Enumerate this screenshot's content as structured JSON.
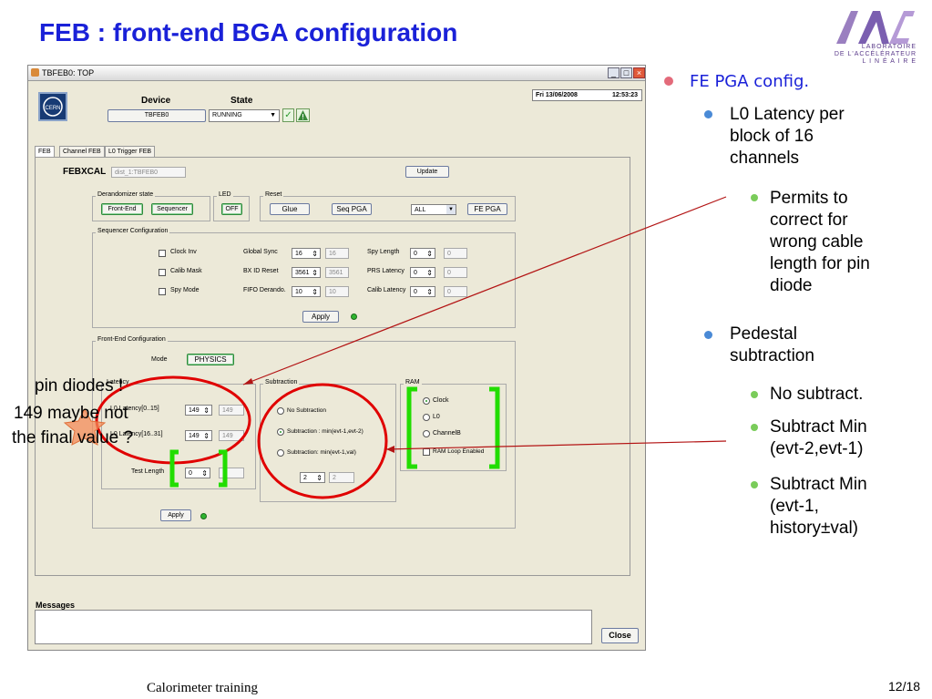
{
  "slide": {
    "title": "FEB : front-end BGA configuration",
    "logo_lines": [
      "LABORATOIRE",
      "DE L'ACCÉLÉRATEUR",
      "L I N É A I R E"
    ],
    "footer_left": "Calorimeter training",
    "page_number": "12/18"
  },
  "window": {
    "title": "TBFEB0: TOP",
    "date": "Fri  13/06/2008",
    "time": "12:53:23",
    "device_label": "Device",
    "device_value": "TBFEB0",
    "state_label": "State",
    "state_value": "RUNNING",
    "tabs": [
      "FEB",
      "Channel FEB",
      "L0 Trigger FEB"
    ],
    "febxcal_label": "FEBXCAL",
    "febxcal_value": "dist_1:TBFEB0",
    "update_button": "Update",
    "derandomizer": {
      "title": "Derandomizer state",
      "buttons": [
        "Front-End",
        "Sequencer"
      ]
    },
    "led": {
      "title": "LED",
      "button": "OFF"
    },
    "reset": {
      "title": "Reset",
      "buttons": [
        "Glue",
        "Seq PGA"
      ],
      "select_value": "ALL",
      "fe_pga_button": "FE PGA"
    },
    "sequencer": {
      "title": "Sequencer Configuration",
      "checkboxes": [
        "Clock Inv",
        "Calib Mask",
        "Spy Mode"
      ],
      "params": [
        {
          "label": "Global Sync",
          "value": "16",
          "readback": "16"
        },
        {
          "label": "BX ID Reset",
          "value": "3561",
          "readback": "3561"
        },
        {
          "label": "FIFO Derando.",
          "value": "10",
          "readback": "10"
        }
      ],
      "params2": [
        {
          "label": "Spy Length",
          "value": "0",
          "readback": "0"
        },
        {
          "label": "PRS Latency",
          "value": "0",
          "readback": "0"
        },
        {
          "label": "Calib Latency",
          "value": "0",
          "readback": "0"
        }
      ],
      "apply_button": "Apply"
    },
    "frontend": {
      "title": "Front-End Configuration",
      "mode_label": "Mode",
      "mode_value": "PHYSICS",
      "latency_group_title": "Latency",
      "latency_rows": [
        {
          "label": "L0 Latency[0..15]",
          "value": "149",
          "readback": "149"
        },
        {
          "label": "L0 Latency[16..31]",
          "value": "149",
          "readback": "149"
        }
      ],
      "test_length_label": "Test Length",
      "test_length_value": "0",
      "subtraction_title": "Subtraction",
      "subtraction_options": [
        "No Subtraction",
        "Subtraction : min(evt-1,evt-2)",
        "Subtraction: min(evt-1,val)"
      ],
      "subtraction_value": "2",
      "subtraction_readback": "2",
      "ram_title": "RAM",
      "ram_options": [
        "Clock",
        "L0",
        "ChannelB"
      ],
      "ram_loop_label": "RAM Loop Enabled",
      "apply_button": "Apply"
    },
    "messages_label": "Messages",
    "close_button": "Close"
  },
  "bullets": {
    "level1": "FE PGA config.",
    "l0_latency": [
      "L0 Latency per",
      "block of 16",
      "channels"
    ],
    "permits": [
      "Permits to",
      "correct for",
      "wrong cable",
      "length for pin",
      "diode"
    ],
    "pedestal": [
      "Pedestal",
      "subtraction"
    ],
    "no_subtract": "No subtract.",
    "sub_min1": [
      "Subtract Min",
      "(evt-2,evt-1)"
    ],
    "sub_min2": [
      "Subtract Min",
      "(evt-1,",
      "history±val)"
    ]
  },
  "annotation": [
    "pin diodes !",
    "149 maybe not",
    "the final value ?"
  ],
  "colors": {
    "title": "#1a21d8",
    "bullet1_text": "#1a21d8",
    "circle": "#e00000",
    "bracket": "#22dd00"
  }
}
